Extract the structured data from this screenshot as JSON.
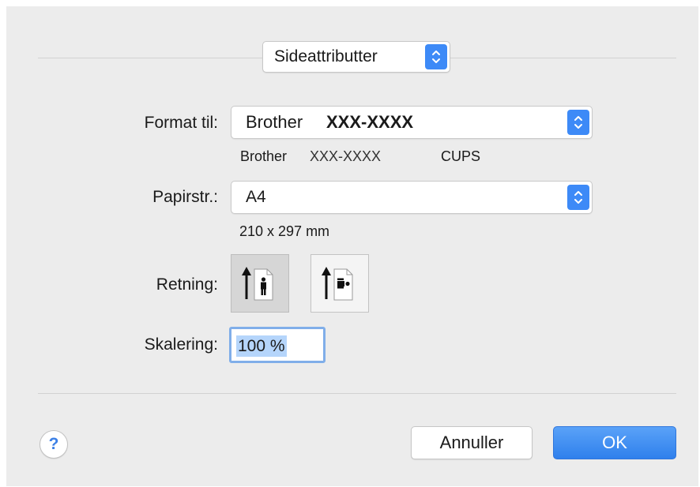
{
  "header": {
    "popup_label": "Sideattributter"
  },
  "format": {
    "label": "Format til:",
    "selected_brand": "Brother",
    "selected_model": "XXX-XXXX",
    "desc_brand": "Brother",
    "desc_model": "XXX-XXXX",
    "desc_driver": "CUPS"
  },
  "paper": {
    "label": "Papirstr.:",
    "selected": "A4",
    "dimensions": "210 x 297 mm"
  },
  "orientation": {
    "label": "Retning:",
    "options": [
      {
        "name": "portrait",
        "selected": true
      },
      {
        "name": "landscape",
        "selected": false
      }
    ]
  },
  "scaling": {
    "label": "Skalering:",
    "value": "100 %"
  },
  "footer": {
    "help_symbol": "?",
    "cancel_label": "Annuller",
    "ok_label": "OK"
  },
  "colors": {
    "accent": "#3d8af7",
    "ok_button": "#3f8ff2",
    "dialog_bg": "#ececec"
  }
}
